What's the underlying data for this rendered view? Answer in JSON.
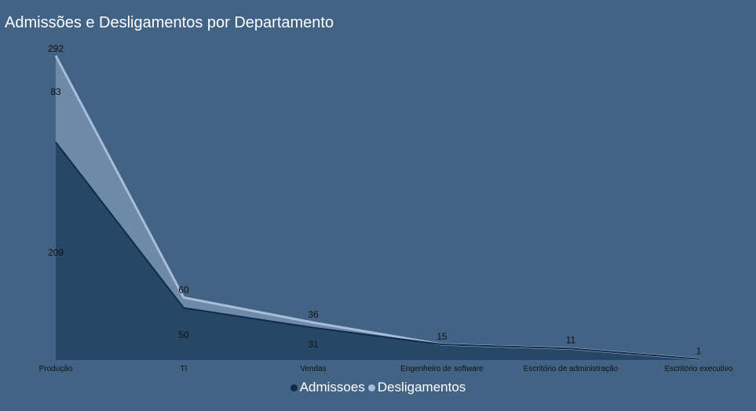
{
  "chart_data": {
    "type": "area",
    "title": "Admissões e Desligamentos por Departamento",
    "categories": [
      "Produção",
      "TI",
      "Vendas",
      "Engenheiro de software",
      "Escritório de administração",
      "Escritório executivo"
    ],
    "stacked": true,
    "series": [
      {
        "name": "Admissoes",
        "values": [
          209,
          50,
          31,
          15,
          11,
          1
        ],
        "color": "#0f2a4a",
        "fill": "#274766",
        "labels": [
          "209",
          "50",
          "31",
          "",
          "",
          "1"
        ]
      },
      {
        "name": "Desligamentos",
        "values": [
          83,
          10,
          5,
          0,
          0,
          0
        ],
        "color": "#a6bedc",
        "fill": "#6e8aa6",
        "labels": [
          "83",
          "",
          "",
          "",
          "",
          ""
        ]
      }
    ],
    "totals": [
      292,
      60,
      36,
      15,
      11,
      1
    ],
    "total_labels": [
      "292",
      "60",
      "36",
      "15",
      "11",
      "1"
    ],
    "ylim": [
      0,
      292
    ],
    "grid": false,
    "legend_position": "bottom"
  }
}
